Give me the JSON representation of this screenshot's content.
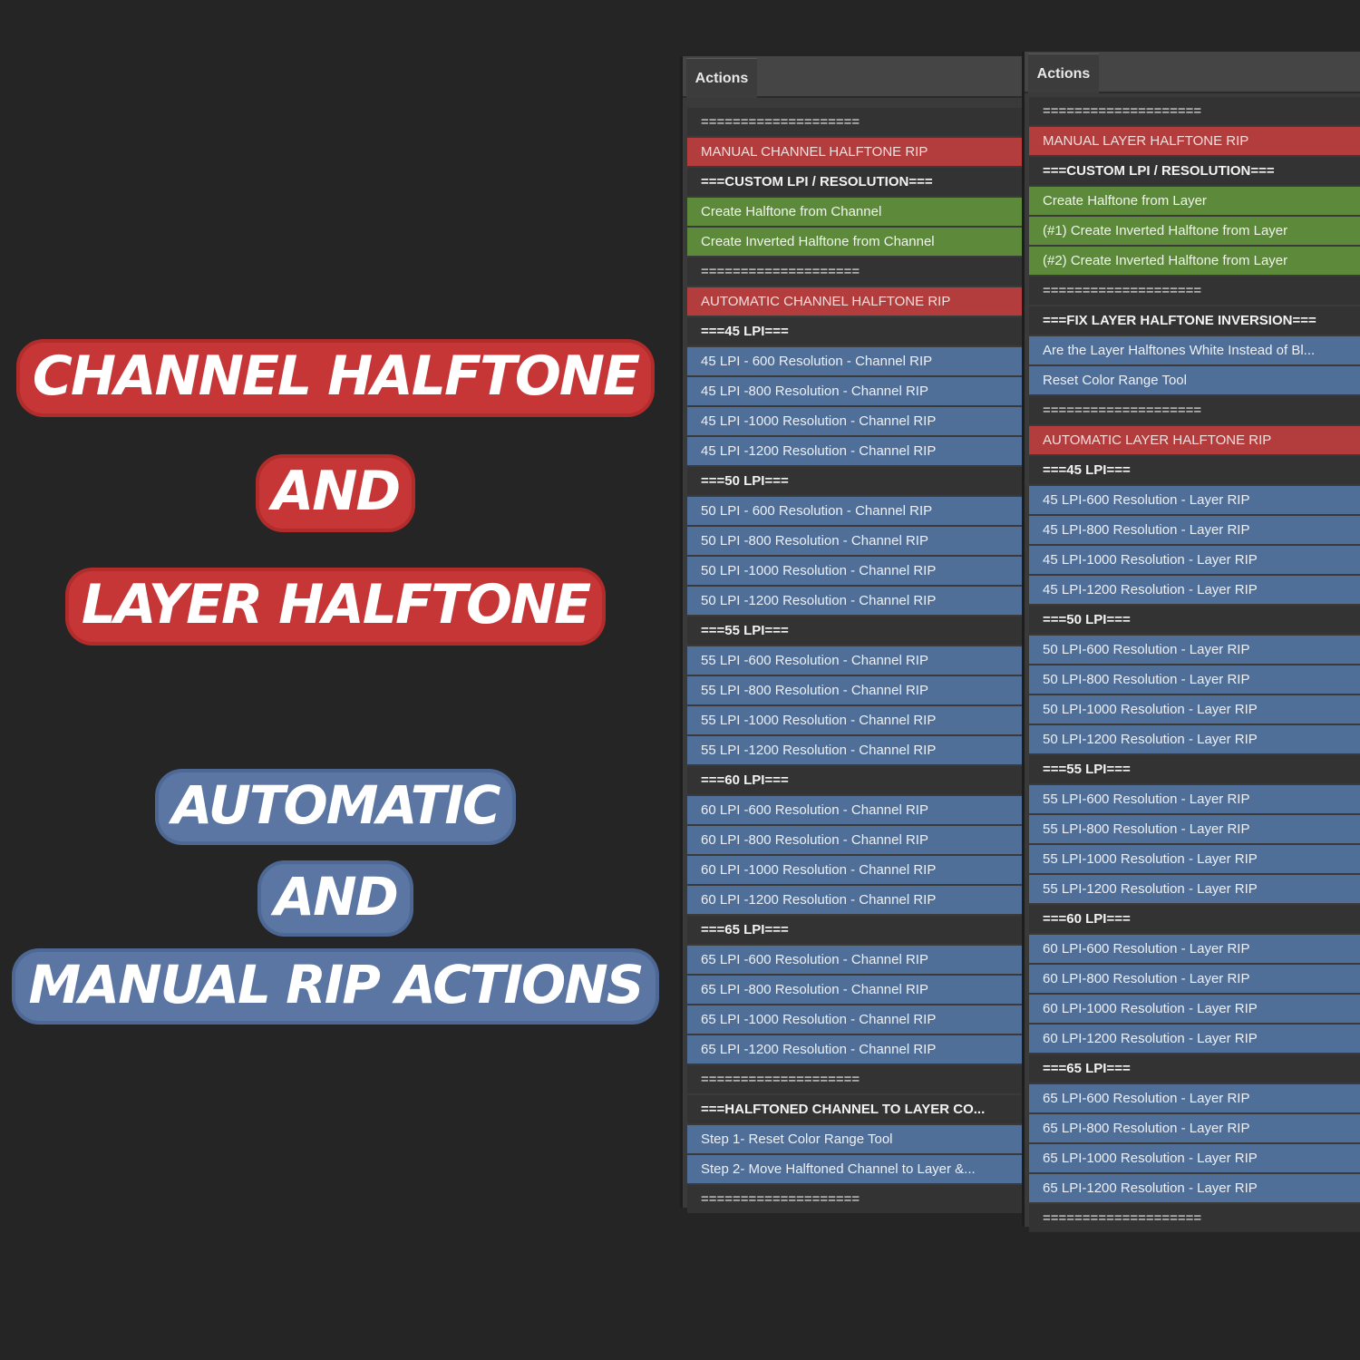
{
  "headlines": {
    "line1": "CHANNEL HALFTONE",
    "line2": "AND",
    "line3": "LAYER HALFTONE",
    "line4": "AUTOMATIC",
    "line5": "AND",
    "line6": "MANUAL RIP ACTIONS"
  },
  "panels": [
    {
      "tab": "Actions",
      "items": [
        {
          "text": "====================",
          "style": "sep"
        },
        {
          "text": "MANUAL CHANNEL HALFTONE RIP",
          "style": "red"
        },
        {
          "text": "===CUSTOM LPI / RESOLUTION===",
          "style": "head"
        },
        {
          "text": "Create Halftone from Channel",
          "style": "green"
        },
        {
          "text": "Create Inverted Halftone from Channel",
          "style": "green"
        },
        {
          "text": "====================",
          "style": "sep"
        },
        {
          "text": "AUTOMATIC CHANNEL HALFTONE RIP",
          "style": "red"
        },
        {
          "text": "===45 LPI===",
          "style": "head"
        },
        {
          "text": "45 LPI - 600 Resolution - Channel RIP",
          "style": "blue"
        },
        {
          "text": "45 LPI -800 Resolution - Channel RIP",
          "style": "blue"
        },
        {
          "text": "45 LPI -1000 Resolution - Channel RIP",
          "style": "blue"
        },
        {
          "text": "45 LPI -1200 Resolution - Channel RIP",
          "style": "blue"
        },
        {
          "text": "===50 LPI===",
          "style": "head"
        },
        {
          "text": "50 LPI - 600 Resolution - Channel RIP",
          "style": "blue"
        },
        {
          "text": "50 LPI -800 Resolution - Channel RIP",
          "style": "blue"
        },
        {
          "text": "50 LPI -1000 Resolution - Channel RIP",
          "style": "blue"
        },
        {
          "text": "50 LPI -1200 Resolution - Channel RIP",
          "style": "blue"
        },
        {
          "text": "===55 LPI===",
          "style": "head"
        },
        {
          "text": "55 LPI -600 Resolution - Channel RIP",
          "style": "blue"
        },
        {
          "text": "55 LPI -800 Resolution - Channel RIP",
          "style": "blue"
        },
        {
          "text": "55 LPI -1000 Resolution - Channel RIP",
          "style": "blue"
        },
        {
          "text": "55 LPI -1200 Resolution - Channel RIP",
          "style": "blue"
        },
        {
          "text": "===60 LPI===",
          "style": "head"
        },
        {
          "text": "60 LPI -600 Resolution - Channel RIP",
          "style": "blue"
        },
        {
          "text": "60 LPI -800 Resolution - Channel RIP",
          "style": "blue"
        },
        {
          "text": "60 LPI -1000 Resolution - Channel RIP",
          "style": "blue"
        },
        {
          "text": "60 LPI -1200 Resolution - Channel RIP",
          "style": "blue"
        },
        {
          "text": "===65 LPI===",
          "style": "head"
        },
        {
          "text": "65 LPI -600 Resolution - Channel RIP",
          "style": "blue"
        },
        {
          "text": "65 LPI -800 Resolution - Channel RIP",
          "style": "blue"
        },
        {
          "text": "65 LPI -1000 Resolution - Channel RIP",
          "style": "blue"
        },
        {
          "text": "65 LPI -1200 Resolution - Channel RIP",
          "style": "blue"
        },
        {
          "text": "====================",
          "style": "sep"
        },
        {
          "text": "===HALFTONED CHANNEL TO LAYER CO...",
          "style": "head"
        },
        {
          "text": "Step 1- Reset Color Range Tool",
          "style": "blue"
        },
        {
          "text": "Step 2- Move Halftoned Channel to Layer &...",
          "style": "blue"
        },
        {
          "text": "====================",
          "style": "sep"
        }
      ]
    },
    {
      "tab": "Actions",
      "items": [
        {
          "text": "====================",
          "style": "sep"
        },
        {
          "text": "MANUAL LAYER HALFTONE RIP",
          "style": "red"
        },
        {
          "text": "===CUSTOM LPI / RESOLUTION===",
          "style": "head"
        },
        {
          "text": "Create Halftone from Layer",
          "style": "green"
        },
        {
          "text": "(#1) Create Inverted Halftone from Layer",
          "style": "green"
        },
        {
          "text": "(#2) Create Inverted Halftone from Layer",
          "style": "green"
        },
        {
          "text": "====================",
          "style": "sep"
        },
        {
          "text": "===FIX LAYER HALFTONE INVERSION===",
          "style": "head"
        },
        {
          "text": "Are the Layer Halftones White Instead of Bl...",
          "style": "blue"
        },
        {
          "text": "Reset Color Range Tool",
          "style": "blue"
        },
        {
          "text": "====================",
          "style": "sep"
        },
        {
          "text": "AUTOMATIC  LAYER HALFTONE RIP",
          "style": "red"
        },
        {
          "text": "===45 LPI===",
          "style": "head"
        },
        {
          "text": "45 LPI-600 Resolution - Layer RIP",
          "style": "blue"
        },
        {
          "text": "45 LPI-800 Resolution - Layer RIP",
          "style": "blue"
        },
        {
          "text": "45 LPI-1000 Resolution - Layer RIP",
          "style": "blue"
        },
        {
          "text": "45 LPI-1200 Resolution - Layer RIP",
          "style": "blue"
        },
        {
          "text": "===50 LPI===",
          "style": "head"
        },
        {
          "text": "50 LPI-600 Resolution - Layer RIP",
          "style": "blue"
        },
        {
          "text": "50 LPI-800 Resolution - Layer RIP",
          "style": "blue"
        },
        {
          "text": "50 LPI-1000 Resolution - Layer RIP",
          "style": "blue"
        },
        {
          "text": "50 LPI-1200 Resolution - Layer RIP",
          "style": "blue"
        },
        {
          "text": "===55 LPI===",
          "style": "head"
        },
        {
          "text": "55 LPI-600 Resolution - Layer RIP",
          "style": "blue"
        },
        {
          "text": "55 LPI-800 Resolution - Layer RIP",
          "style": "blue"
        },
        {
          "text": "55 LPI-1000 Resolution - Layer RIP",
          "style": "blue"
        },
        {
          "text": "55 LPI-1200 Resolution - Layer RIP",
          "style": "blue"
        },
        {
          "text": "===60 LPI===",
          "style": "head"
        },
        {
          "text": "60 LPI-600 Resolution - Layer RIP",
          "style": "blue"
        },
        {
          "text": "60 LPI-800 Resolution - Layer RIP",
          "style": "blue"
        },
        {
          "text": "60 LPI-1000 Resolution - Layer RIP",
          "style": "blue"
        },
        {
          "text": "60 LPI-1200 Resolution - Layer RIP",
          "style": "blue"
        },
        {
          "text": "===65 LPI===",
          "style": "head"
        },
        {
          "text": "65 LPI-600 Resolution - Layer RIP",
          "style": "blue"
        },
        {
          "text": "65 LPI-800 Resolution - Layer RIP",
          "style": "blue"
        },
        {
          "text": "65 LPI-1000 Resolution - Layer RIP",
          "style": "blue"
        },
        {
          "text": "65 LPI-1200 Resolution - Layer RIP",
          "style": "blue"
        },
        {
          "text": "====================",
          "style": "sep"
        }
      ]
    }
  ]
}
